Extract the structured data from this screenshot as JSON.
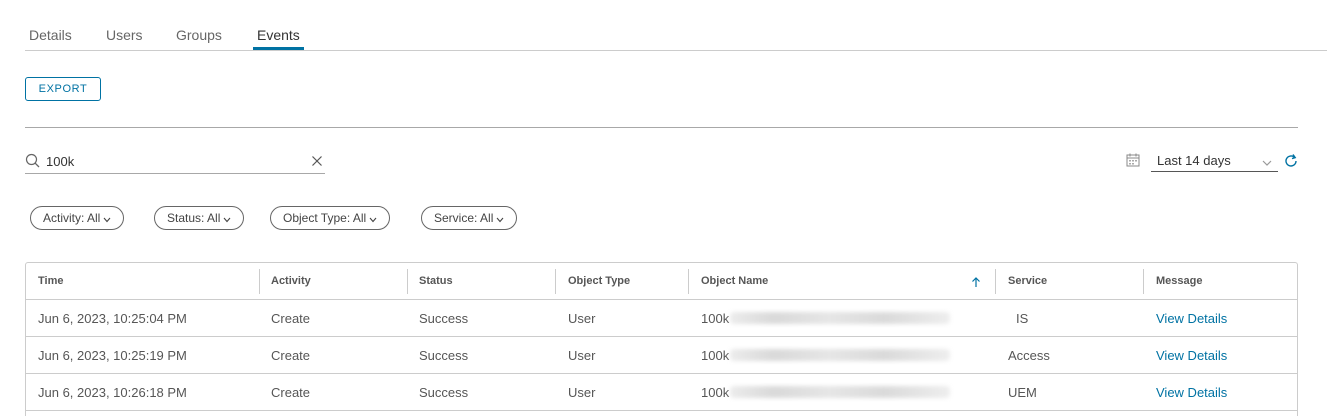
{
  "tabs": [
    {
      "label": "Details"
    },
    {
      "label": "Users"
    },
    {
      "label": "Groups"
    },
    {
      "label": "Events"
    }
  ],
  "export_label": "EXPORT",
  "search": {
    "value": "100k"
  },
  "date_range": {
    "value": "Last 14 days"
  },
  "filters": [
    {
      "label": "Activity: All"
    },
    {
      "label": "Status: All"
    },
    {
      "label": "Object Type: All"
    },
    {
      "label": "Service: All"
    }
  ],
  "table": {
    "columns": [
      "Time",
      "Activity",
      "Status",
      "Object Type",
      "Object Name",
      "Service",
      "Message"
    ],
    "sorted_column": "Object Name",
    "sort_direction": "ascending",
    "rows": [
      {
        "time": "Jun 6, 2023, 10:25:04 PM",
        "activity": "Create",
        "status": "Success",
        "object_type": "User",
        "object_name": "100k",
        "service": "IS",
        "message": "View Details"
      },
      {
        "time": "Jun 6, 2023, 10:25:19 PM",
        "activity": "Create",
        "status": "Success",
        "object_type": "User",
        "object_name": "100k",
        "service": "Access",
        "message": "View Details"
      },
      {
        "time": "Jun 6, 2023, 10:26:18 PM",
        "activity": "Create",
        "status": "Success",
        "object_type": "User",
        "object_name": "100k",
        "service": "UEM",
        "message": "View Details"
      }
    ]
  },
  "colors": {
    "accent": "#0072a3",
    "border": "#cccccc",
    "text": "#565656"
  }
}
